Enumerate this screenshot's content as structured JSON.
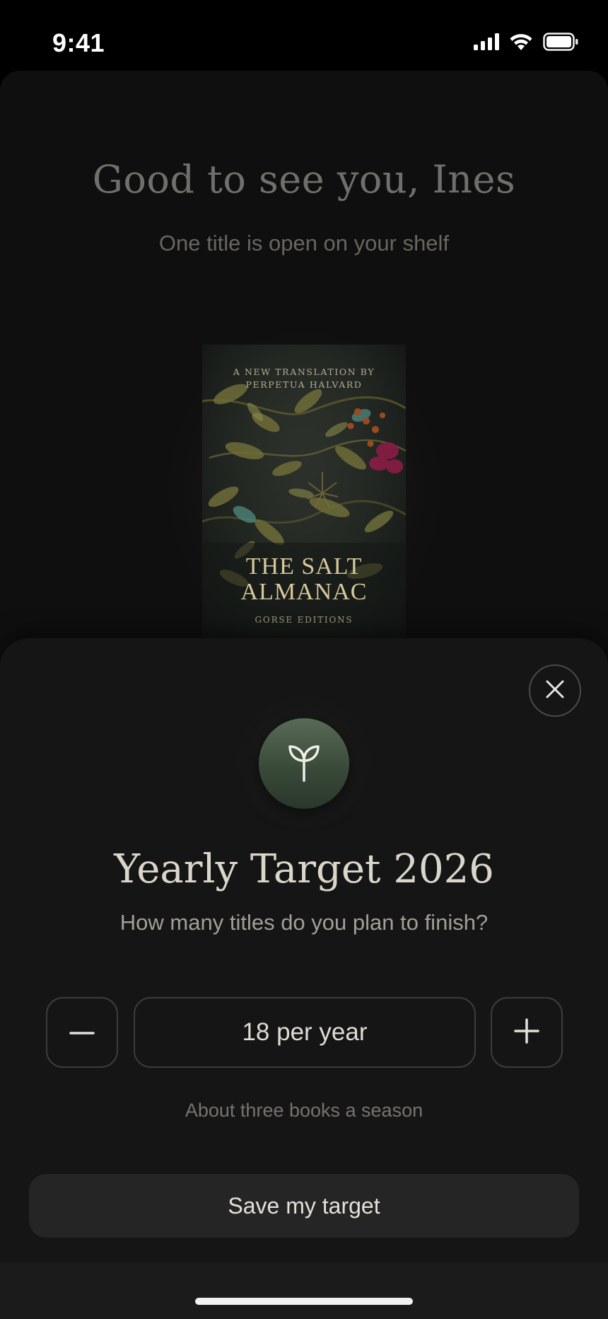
{
  "status_bar": {
    "time": "9:41",
    "icons": [
      "cellular-signal-icon",
      "wifi-icon",
      "battery-icon"
    ]
  },
  "home": {
    "greeting": "Good to see you, Ines",
    "subtitle": "One title is open on your shelf",
    "book": {
      "credit_line1": "A NEW TRANSLATION BY",
      "credit_line2": "PERPETUA HALVARD",
      "title_line1": "THE SALT",
      "title_line2": "ALMANAC",
      "publisher": "GORSE EDITIONS"
    }
  },
  "sheet": {
    "icon": "sprout-icon",
    "title": "Yearly Target 2026",
    "subtitle": "How many titles do you plan to finish?",
    "stepper": {
      "value": "18 per year",
      "decrement_icon": "minus-icon",
      "increment_icon": "plus-icon"
    },
    "hint": "About three books a season",
    "save_label": "Save my target",
    "close_icon": "close-icon"
  },
  "colors": {
    "background": "#000000",
    "card": "#0f0f0f",
    "sheet": "#151515",
    "accent_green": "#4a5c49",
    "book_gold": "#d8c89a"
  }
}
